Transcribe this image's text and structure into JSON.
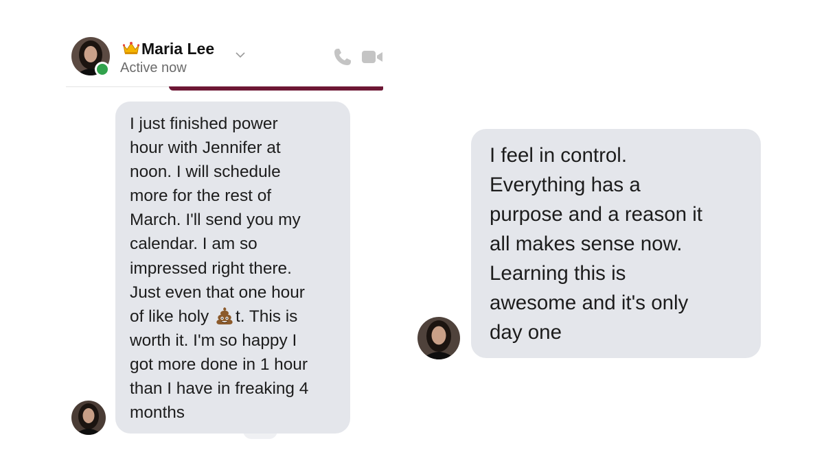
{
  "header": {
    "name": "Maria Lee",
    "status": "Active now",
    "crown_icon": "crown-emoji-icon",
    "chevron_icon": "chevron-down-icon",
    "phone_icon": "phone-icon",
    "video_icon": "video-camera-icon",
    "presence_color": "#31a24c"
  },
  "messages_left": {
    "text_1": "I just finished power\nhour with Jennifer at\nnoon. I will schedule\nmore for the rest of\nMarch. I'll send you my\ncalendar. I am so\nimpressed right there.\nJust even that one hour\nof like holy ",
    "censored_emoji": "poop-emoji-icon",
    "text_2": "t. This is\nworth it. I'm so happy I\ngot more done in 1 hour\nthan I have in freaking 4\nmonths"
  },
  "messages_right": {
    "text": "I feel in control.\nEverything has a\npurpose and a reason it\nall makes sense now.\nLearning this is\nawesome and it's only\nday one"
  },
  "colors": {
    "bubble": "#e4e6eb",
    "accent": "#6d1735",
    "status_text": "#6b6b6b"
  }
}
